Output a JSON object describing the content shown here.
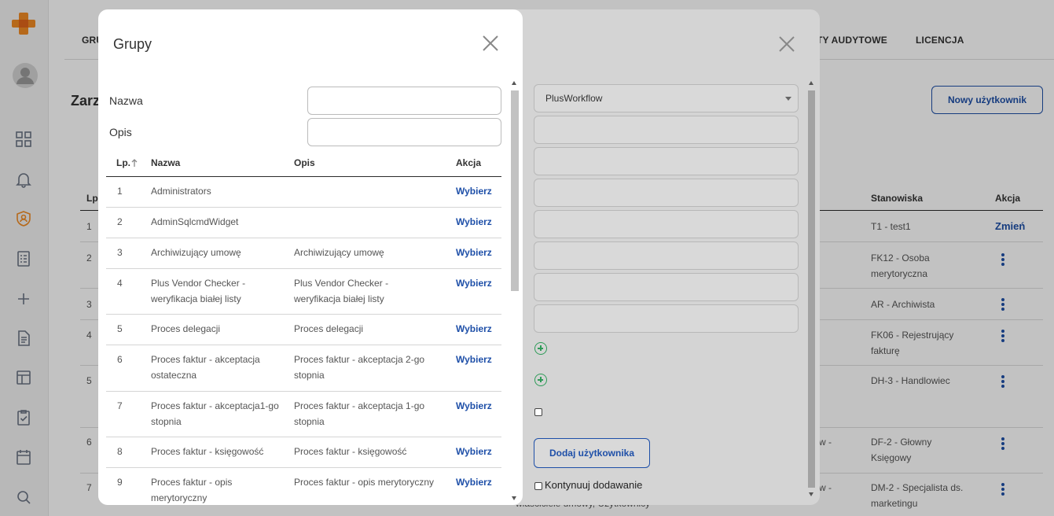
{
  "sidenav": {
    "icons": [
      "logo-icon",
      "avatar-icon",
      "dashboard-icon",
      "bell-icon",
      "user-shield-icon",
      "checklist-icon",
      "plus-icon",
      "document-icon",
      "layout-icon",
      "clipboard-check-icon",
      "calendar-icon",
      "search-icon"
    ],
    "accent_color": "#f08a24"
  },
  "page": {
    "top_nav": {
      "tab_left": "GRU",
      "tab_audit": "TY AUDYTOWE",
      "tab_license": "LICENCJA"
    },
    "title": "Zarz",
    "new_user_button": "Nowy użytkownik",
    "table": {
      "col_lp": "Lp.",
      "col_positions": "Stanowiska",
      "col_action": "Akcja",
      "rows": [
        {
          "lp": "1",
          "positions": "T1 - test1",
          "action": "Zmień"
        },
        {
          "lp": "2",
          "positions": "FK12 - Osoba merytoryczna"
        },
        {
          "lp": "3",
          "positions": "AR - Archiwista"
        },
        {
          "lp": "4",
          "positions": "FK06 - Rejestrujący fakturę"
        },
        {
          "lp": "5",
          "positions": "DH-3 - Handlowiec"
        },
        {
          "lp": "6",
          "mid": "w -",
          "positions": "DF-2 - Głowny Księgowy"
        },
        {
          "lp": "7",
          "mid": "w -",
          "positions": "DM-2 - Specjalista ds. marketingu",
          "bottom": "właściciele umowy, Użytkownicy"
        }
      ]
    }
  },
  "user_modal": {
    "workflow_select": "PlusWorkflow",
    "add_user_button": "Dodaj użytkownika",
    "continue_label": "Kontynuuj dodawanie"
  },
  "groups_modal": {
    "title": "Grupy",
    "filter_name_label": "Nazwa",
    "filter_desc_label": "Opis",
    "filter_name_value": "",
    "filter_desc_value": "",
    "columns": {
      "lp": "Lp.",
      "name": "Nazwa",
      "desc": "Opis",
      "action": "Akcja"
    },
    "rows": [
      {
        "lp": "1",
        "name": "Administrators",
        "desc": "",
        "action": "Wybierz"
      },
      {
        "lp": "2",
        "name": "AdminSqlcmdWidget",
        "desc": "",
        "action": "Wybierz"
      },
      {
        "lp": "3",
        "name": "Archiwizujący umowę",
        "desc": "Archiwizujący umowę",
        "action": "Wybierz"
      },
      {
        "lp": "4",
        "name": "Plus Vendor Checker - weryfikacja białej listy",
        "desc": "Plus Vendor Checker - weryfikacja białej listy",
        "action": "Wybierz"
      },
      {
        "lp": "5",
        "name": "Proces delegacji",
        "desc": "Proces delegacji",
        "action": "Wybierz"
      },
      {
        "lp": "6",
        "name": "Proces faktur - akceptacja ostateczna",
        "desc": "Proces faktur - akceptacja 2-go stopnia",
        "action": "Wybierz"
      },
      {
        "lp": "7",
        "name": "Proces faktur - akceptacja1-go stopnia",
        "desc": "Proces faktur - akceptacja 1-go stopnia",
        "action": "Wybierz"
      },
      {
        "lp": "8",
        "name": "Proces faktur - księgowość",
        "desc": "Proces faktur - księgowość",
        "action": "Wybierz"
      },
      {
        "lp": "9",
        "name": "Proces faktur - opis merytoryczny",
        "desc": "Proces faktur - opis merytoryczny",
        "action": "Wybierz"
      }
    ]
  }
}
